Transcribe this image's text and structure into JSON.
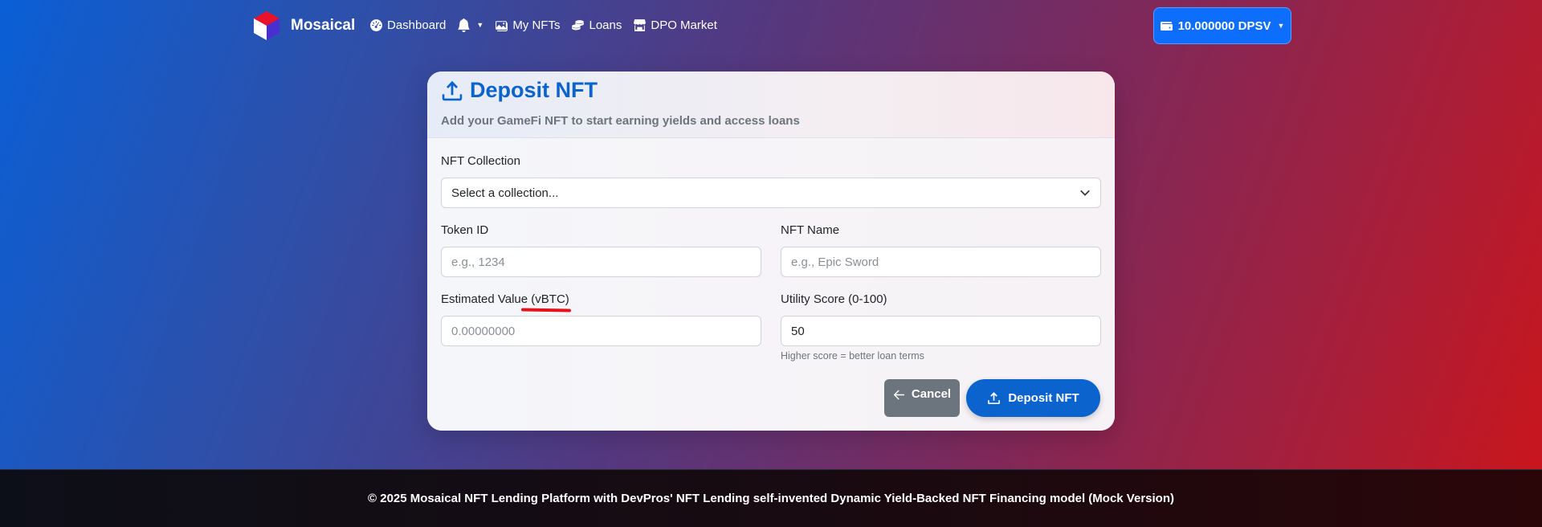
{
  "brand": {
    "name": "Mosaical"
  },
  "nav": {
    "dashboard": "Dashboard",
    "my_nfts": "My NFTs",
    "loans": "Loans",
    "dpo_market": "DPO Market"
  },
  "wallet": {
    "balance": "10.000000 DPSV"
  },
  "card": {
    "title": "Deposit NFT",
    "subtitle": "Add your GameFi NFT to start earning yields and access loans"
  },
  "form": {
    "collection_label": "NFT Collection",
    "collection_selected": "Select a collection...",
    "token_id_label": "Token ID",
    "token_id_placeholder": "e.g., 1234",
    "nft_name_label": "NFT Name",
    "nft_name_placeholder": "e.g., Epic Sword",
    "value_label": "Estimated Value (vBTC)",
    "value_placeholder": "0.00000000",
    "utility_label": "Utility Score (0-100)",
    "utility_value": "50",
    "utility_help": "Higher score = better loan terms"
  },
  "buttons": {
    "cancel": "Cancel",
    "deposit": "Deposit NFT"
  },
  "footer": {
    "text": "© 2025 Mosaical NFT Lending Platform with DevPros' NFT Lending self-invented Dynamic Yield-Backed NFT Financing model (Mock Version)"
  },
  "colors": {
    "primary": "#0b63ce",
    "secondary": "#6c757d",
    "annotation": "#e3121b"
  }
}
